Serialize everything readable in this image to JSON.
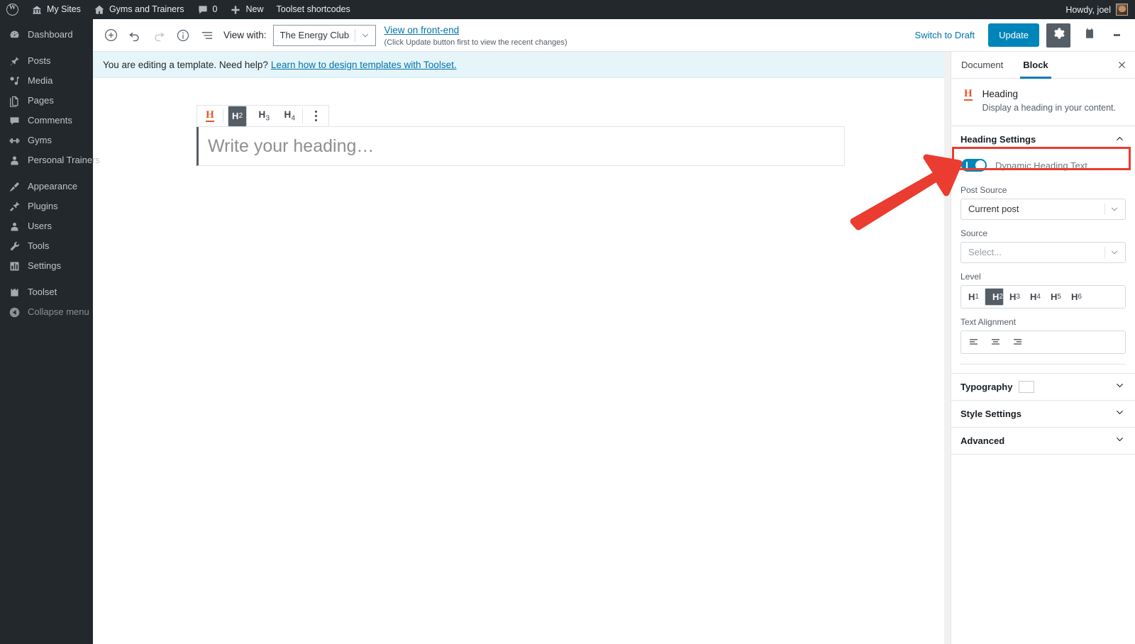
{
  "adminbar": {
    "logo_icon": "wordpress-logo-icon",
    "items": [
      {
        "icon": "sites-icon",
        "label": "My Sites"
      },
      {
        "icon": "home-icon",
        "label": "Gyms and Trainers"
      },
      {
        "icon": "comment-icon",
        "label": "0"
      },
      {
        "icon": "plus-icon",
        "label": "New"
      },
      {
        "icon": "",
        "label": "Toolset shortcodes"
      }
    ],
    "howdy": "Howdy, joel",
    "avatar_icon": "user-avatar"
  },
  "adminmenu": {
    "items": [
      {
        "icon": "dashboard-icon",
        "label": "Dashboard",
        "sep_after": true
      },
      {
        "icon": "post-icon",
        "label": "Posts",
        "sep_after": false
      },
      {
        "icon": "media-icon",
        "label": "Media",
        "sep_after": false
      },
      {
        "icon": "pages-icon",
        "label": "Pages",
        "sep_after": false
      },
      {
        "icon": "comments-icon",
        "label": "Comments",
        "sep_after": false
      },
      {
        "icon": "gyms-icon",
        "label": "Gyms",
        "sep_after": false
      },
      {
        "icon": "trainers-icon",
        "label": "Personal Trainers",
        "sep_after": true
      },
      {
        "icon": "appearance-icon",
        "label": "Appearance",
        "sep_after": false
      },
      {
        "icon": "plugins-icon",
        "label": "Plugins",
        "sep_after": false
      },
      {
        "icon": "users-icon",
        "label": "Users",
        "sep_after": false
      },
      {
        "icon": "tools-icon",
        "label": "Tools",
        "sep_after": false
      },
      {
        "icon": "settings-icon",
        "label": "Settings",
        "sep_after": true
      },
      {
        "icon": "toolset-icon",
        "label": "Toolset",
        "sep_after": false
      },
      {
        "icon": "collapse-icon",
        "label": "Collapse menu",
        "sep_after": false
      }
    ]
  },
  "editor_header": {
    "add_block_icon": "plus-circle-icon",
    "undo_icon": "undo-icon",
    "redo_icon": "redo-icon",
    "info_icon": "info-circle-icon",
    "list_view_icon": "list-view-icon",
    "view_with_label": "View with:",
    "view_with_value": "The Energy Club",
    "front_end_link": "View on front-end",
    "front_end_note": "(Click Update button first to view the recent changes)",
    "switch_to_draft": "Switch to Draft",
    "update_label": "Update",
    "settings_icon": "gear-icon",
    "toolset_icon": "toolset-bag-icon",
    "more_icon": "kebab-menu-icon"
  },
  "notice": {
    "text": "You are editing a template. Need help?",
    "link": "Learn how to design templates with Toolset."
  },
  "block_toolbar": {
    "type_icon": "heading-block-icon",
    "levels": [
      "H2",
      "H3",
      "H4"
    ],
    "selected_level": "H2",
    "more_icon": "vertical-dots-icon"
  },
  "heading_block": {
    "placeholder": "Write your heading…"
  },
  "sidebar": {
    "tabs": [
      {
        "label": "Document",
        "active": false
      },
      {
        "label": "Block",
        "active": true
      }
    ],
    "close_icon": "close-icon",
    "block_info": {
      "icon": "heading-block-icon",
      "title": "Heading",
      "description": "Display a heading in your content."
    },
    "heading_settings": {
      "title": "Heading Settings",
      "expanded": true,
      "collapse_icon": "chevron-up-icon",
      "dynamic_toggle": {
        "label": "Dynamic Heading Text",
        "state": "on"
      },
      "post_source": {
        "label": "Post Source",
        "value": "Current post",
        "caret_icon": "chevron-down-icon"
      },
      "source": {
        "label": "Source",
        "value": "Select...",
        "caret_icon": "chevron-down-icon"
      },
      "level": {
        "label": "Level",
        "options": [
          "H1",
          "H2",
          "H3",
          "H4",
          "H5",
          "H6"
        ],
        "selected": "H2"
      },
      "text_alignment": {
        "label": "Text Alignment",
        "options": [
          "align-left-icon",
          "align-center-icon",
          "align-right-icon"
        ],
        "selected": ""
      }
    },
    "panels": [
      {
        "title": "Typography",
        "has_swatch": true,
        "expand_icon": "chevron-down-icon"
      },
      {
        "title": "Style Settings",
        "has_swatch": false,
        "expand_icon": "chevron-down-icon"
      },
      {
        "title": "Advanced",
        "has_swatch": false,
        "expand_icon": "chevron-down-icon"
      }
    ]
  },
  "annotation": {
    "highlight_color": "#ea3c30",
    "arrow_color": "#ea3c30",
    "target": "dynamic-heading-text-toggle"
  },
  "colors": {
    "admin_dark": "#23282d",
    "accent_blue": "#0085ba",
    "tab_underline": "#007cba",
    "link_blue": "#0073aa",
    "notice_bg": "#e5f5fa",
    "heading_icon_orange": "#e2562b",
    "annotation_red": "#ea3c30"
  }
}
